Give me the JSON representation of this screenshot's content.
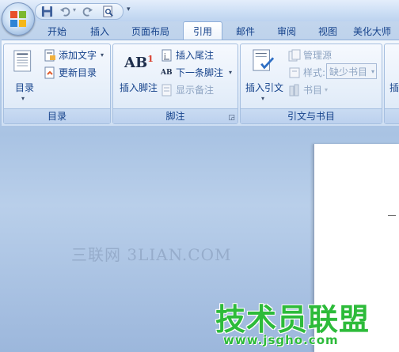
{
  "title_bar": {
    "quick_access": [
      "save",
      "undo",
      "redo",
      "print-preview"
    ]
  },
  "tabs": [
    {
      "label": "开始",
      "active": false
    },
    {
      "label": "插入",
      "active": false
    },
    {
      "label": "页面布局",
      "active": false
    },
    {
      "label": "引用",
      "active": true
    },
    {
      "label": "邮件",
      "active": false
    },
    {
      "label": "审阅",
      "active": false
    },
    {
      "label": "视图",
      "active": false
    },
    {
      "label": "美化大师",
      "active": false
    }
  ],
  "groups": {
    "toc": {
      "label": "目录",
      "big_button": "目录",
      "add_text": "添加文字",
      "update_toc": "更新目录"
    },
    "footnotes": {
      "label": "脚注",
      "big_button": "插入脚注",
      "big_icon_text": "AB",
      "big_icon_sup": "1",
      "insert_endnote": "插入尾注",
      "next_footnote": "下一条脚注",
      "show_notes": "显示备注",
      "small_icon_text": "AB"
    },
    "citations": {
      "label": "引文与书目",
      "big_button": "插入引文",
      "manage_sources": "管理源",
      "style_label": "样式:",
      "style_value": "缺少书目",
      "bibliography": "书目"
    },
    "partial_next": {
      "fragment": "插"
    }
  },
  "watermarks": {
    "top": "三联网 3LIAN.COM",
    "main": "技术员联盟",
    "url": "www.jsgho.com"
  }
}
